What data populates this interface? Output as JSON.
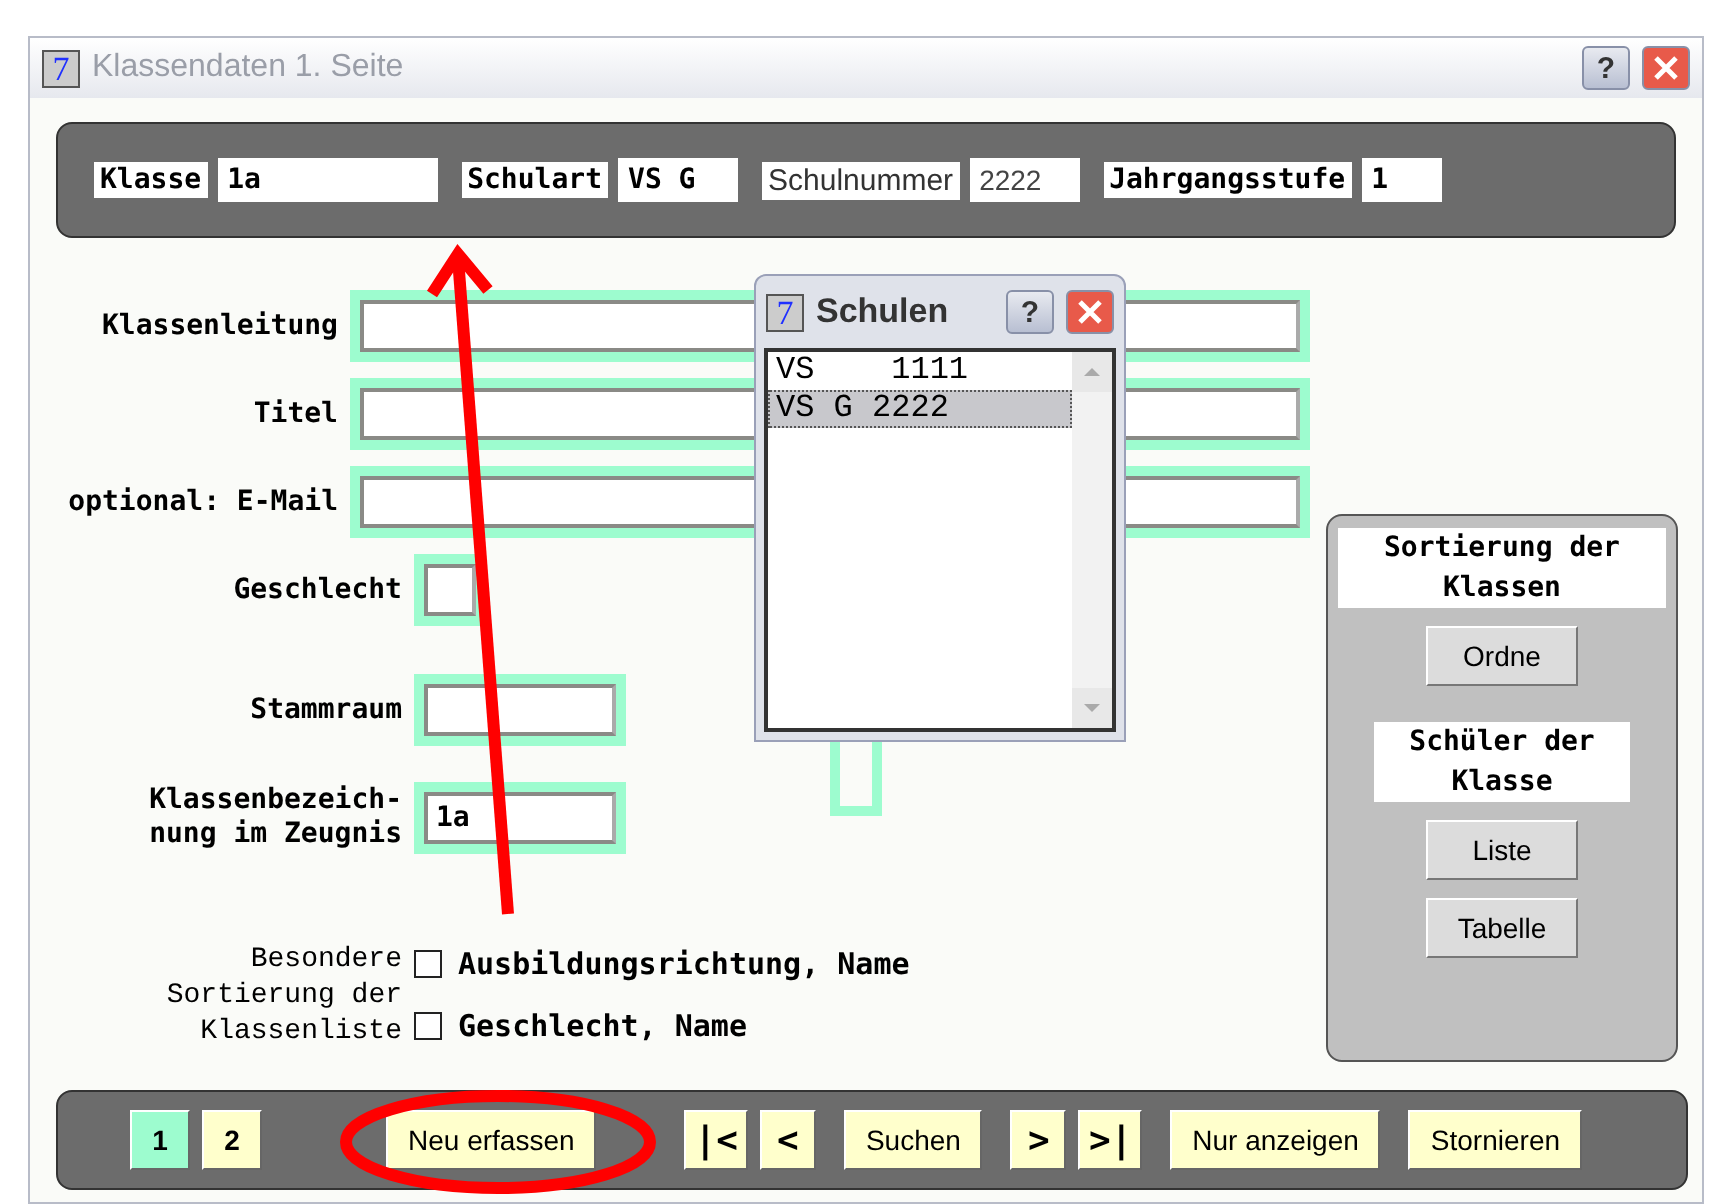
{
  "window": {
    "title": "Klassendaten 1. Seite",
    "icon_text": "7",
    "help": "?"
  },
  "header": {
    "fields": [
      {
        "label": "Klasse",
        "value": "1a",
        "kind": "bold"
      },
      {
        "label": "Schulart",
        "value": "VS G",
        "kind": "bold"
      },
      {
        "label": "Schulnummer",
        "value": "2222",
        "kind": "plain"
      },
      {
        "label": "Jahrgangsstufe",
        "value": "1",
        "kind": "bold"
      }
    ]
  },
  "form": {
    "fields": [
      {
        "label": "Klassenleitung"
      },
      {
        "label": "Titel"
      },
      {
        "label": "optional: E-Mail"
      },
      {
        "label": "Geschlecht"
      },
      {
        "label": "Stammraum"
      },
      {
        "label": "Klassenbezeich-\nnung im Zeugnis",
        "value": "1a"
      }
    ],
    "sort_label": "Besondere\nSortierung der\nKlassenliste",
    "sort_options": [
      {
        "label": "Ausbildungsrichtung, Name",
        "checked": false
      },
      {
        "label": "Geschlecht, Name",
        "checked": false
      }
    ]
  },
  "side_panel": {
    "sections": [
      {
        "title": "Sortierung der\nKlassen",
        "buttons": [
          {
            "label": "Ordne"
          }
        ]
      },
      {
        "title": "Schüler der\nKlasse",
        "buttons": [
          {
            "label": "Liste"
          },
          {
            "label": "Tabelle"
          }
        ]
      }
    ]
  },
  "bottom_bar": {
    "pages": [
      {
        "label": "1",
        "selected": true
      },
      {
        "label": "2",
        "selected": false
      }
    ],
    "buttons": [
      {
        "label": "Neu erfassen",
        "kind": "text"
      },
      {
        "label": "|<",
        "kind": "nav"
      },
      {
        "label": "<",
        "kind": "nav"
      },
      {
        "label": "Suchen",
        "kind": "text"
      },
      {
        "label": ">",
        "kind": "nav"
      },
      {
        "label": ">|",
        "kind": "nav"
      },
      {
        "label": "Nur anzeigen",
        "kind": "text"
      },
      {
        "label": "Stornieren",
        "kind": "text"
      }
    ]
  },
  "popup": {
    "title": "Schulen",
    "icon_text": "7",
    "help": "?",
    "items": [
      {
        "label": "VS    1111",
        "selected": false
      },
      {
        "label": "VS G 2222",
        "selected": true
      }
    ]
  }
}
